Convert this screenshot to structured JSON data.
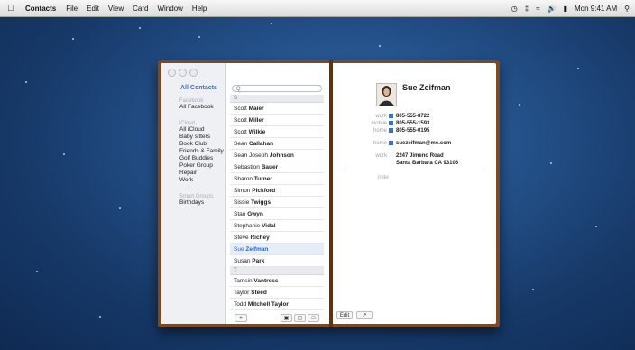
{
  "menubar": {
    "app_name": "Contacts",
    "menus": [
      "File",
      "Edit",
      "View",
      "Card",
      "Window",
      "Help"
    ],
    "clock": "Mon 9:41 AM"
  },
  "sidebar": {
    "all_contacts": "All Contacts",
    "facebook_header": "Facebook",
    "facebook_items": [
      "All Facebook"
    ],
    "icloud_header": "iCloud",
    "icloud_items": [
      "All iCloud",
      "Baby sitters",
      "Book Club",
      "Friends & Family",
      "Golf Buddies",
      "Poker Group",
      "Repair",
      "Work"
    ],
    "smart_header": "Smart Groups",
    "smart_items": [
      "Birthdays"
    ]
  },
  "list": {
    "search_placeholder": "Q",
    "rows": [
      {
        "type": "header",
        "text": "S"
      },
      {
        "first": "Scott",
        "last": "Maier"
      },
      {
        "first": "Scott",
        "last": "Miller"
      },
      {
        "first": "Scott",
        "last": "Wilkie"
      },
      {
        "first": "Sean",
        "last": "Callahan"
      },
      {
        "first": "Sean Joseph",
        "last": "Johnson"
      },
      {
        "first": "Sebastion",
        "last": "Bauer"
      },
      {
        "first": "Sharon",
        "last": "Turner"
      },
      {
        "first": "Simon",
        "last": "Pickford"
      },
      {
        "first": "Sissie",
        "last": "Twiggs"
      },
      {
        "first": "Stan",
        "last": "Gwyn"
      },
      {
        "first": "Stephanie",
        "last": "Vidal"
      },
      {
        "first": "Steve",
        "last": "Richey"
      },
      {
        "first": "Sue",
        "last": "Zeifman",
        "selected": true
      },
      {
        "first": "Susan",
        "last": "Park"
      },
      {
        "type": "header",
        "text": "T"
      },
      {
        "first": "Tamsin",
        "last": "Vantress"
      },
      {
        "first": "Taylor",
        "last": "Steed"
      },
      {
        "first": "Todd",
        "last": "Mitchell Taylor"
      }
    ],
    "add_label": "+"
  },
  "card": {
    "name": "Sue Zeifman",
    "phones": [
      {
        "label": "work",
        "value": "805-555-8722"
      },
      {
        "label": "mobile",
        "value": "805-555-1593"
      },
      {
        "label": "home",
        "value": "805-555-0195"
      }
    ],
    "email": {
      "label": "home",
      "value": "suezeifman@me.com"
    },
    "address": {
      "label": "work",
      "line1": "2247 Jimeno Road",
      "line2": "Santa Barbara CA 93103"
    },
    "note_label": "note",
    "edit_label": "Edit"
  },
  "accent": "#3a6fc7"
}
